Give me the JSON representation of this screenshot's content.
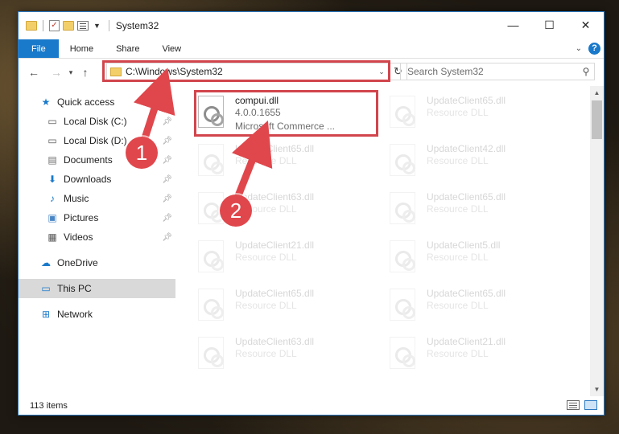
{
  "window": {
    "title": "System32",
    "controls": {
      "minimize": "—",
      "maximize": "☐",
      "close": "✕"
    }
  },
  "ribbon": {
    "tabs": [
      {
        "label": "File"
      },
      {
        "label": "Home"
      },
      {
        "label": "Share"
      },
      {
        "label": "View"
      }
    ],
    "help": "?"
  },
  "navigation": {
    "address": "C:\\Windows\\System32",
    "search_placeholder": "Search System32"
  },
  "sidebar": {
    "quick_access": "Quick access",
    "items": [
      {
        "label": "Local Disk (C:)",
        "icon": "drive-icon"
      },
      {
        "label": "Local Disk (D:)",
        "icon": "drive-icon"
      },
      {
        "label": "Documents",
        "icon": "documents-icon"
      },
      {
        "label": "Downloads",
        "icon": "downloads-icon"
      },
      {
        "label": "Music",
        "icon": "music-icon"
      },
      {
        "label": "Pictures",
        "icon": "pictures-icon"
      },
      {
        "label": "Videos",
        "icon": "videos-icon"
      }
    ],
    "onedrive": "OneDrive",
    "this_pc": "This PC",
    "network": "Network"
  },
  "files": {
    "highlighted": {
      "name": "compui.dll",
      "version": "4.0.0.1655",
      "description": "Microsoft Commerce ..."
    },
    "faded": [
      {
        "name": "UpdateClient65.dll",
        "description": "Resource DLL"
      },
      {
        "name": "UpdateClient65.dll",
        "description": "Resource DLL"
      },
      {
        "name": "UpdateClient42.dll",
        "description": "Resource DLL"
      },
      {
        "name": "UpdateClient63.dll",
        "description": "Resource DLL"
      },
      {
        "name": "UpdateClient65.dll",
        "description": "Resource DLL"
      },
      {
        "name": "UpdateClient21.dll",
        "description": "Resource DLL"
      },
      {
        "name": "UpdateClient5.dll",
        "description": "Resource DLL"
      },
      {
        "name": "UpdateClient65.dll",
        "description": "Resource DLL"
      },
      {
        "name": "UpdateClient65.dll",
        "description": "Resource DLL"
      },
      {
        "name": "UpdateClient63.dll",
        "description": "Resource DLL"
      },
      {
        "name": "UpdateClient21.dll",
        "description": "Resource DLL"
      }
    ]
  },
  "status": {
    "item_count": "113 items"
  },
  "annotations": {
    "step1": "1",
    "step2": "2",
    "color": "#e0474c"
  }
}
